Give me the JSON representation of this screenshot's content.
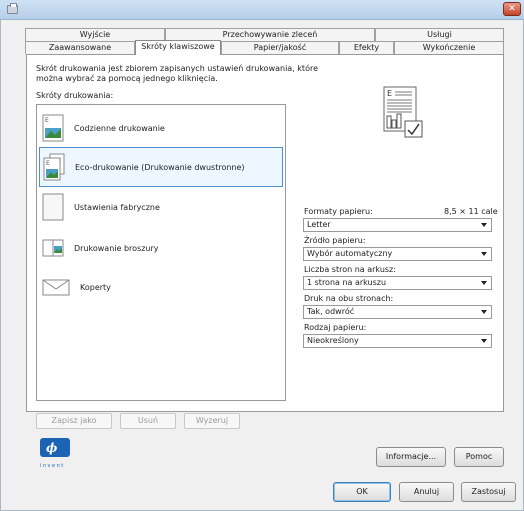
{
  "tabs_row1": [
    "Wyjście",
    "Przechowywanie zleceń",
    "Usługi"
  ],
  "tabs_row2": [
    "Zaawansowane",
    "Skróty klawiszowe",
    "Papier/jakość",
    "Efekty",
    "Wykończenie"
  ],
  "description": "Skrót drukowania jest zbiorem zapisanych ustawień drukowania, które można wybrać za pomocą jednego kliknięcia.",
  "shortcuts_label": "Skróty drukowania:",
  "shortcuts": [
    {
      "label": "Codzienne drukowanie",
      "icon": "doc-landscape-icon"
    },
    {
      "label": "Eco-drukowanie (Drukowanie dwustronne)",
      "icon": "duplex-doc-icon"
    },
    {
      "label": "Ustawienia fabryczne",
      "icon": "blank-page-icon"
    },
    {
      "label": "Drukowanie broszury",
      "icon": "booklet-icon"
    },
    {
      "label": "Koperty",
      "icon": "envelope-icon"
    }
  ],
  "list_buttons": {
    "save_as": "Zapisz jako",
    "delete": "Usuń",
    "reset": "Wyzeruj"
  },
  "paper_sizes_label": "Formaty papieru:",
  "paper_size_value": "8,5 × 11 cale",
  "paper_size_select": "Letter",
  "paper_source_label": "Źródło papieru:",
  "paper_source_select": "Wybór automatyczny",
  "pages_per_sheet_label": "Liczba stron na arkusz:",
  "pages_per_sheet_select": "1 strona na arkuszu",
  "duplex_label": "Druk na obu stronach:",
  "duplex_select": "Tak, odwróć",
  "paper_type_label": "Rodzaj papieru:",
  "paper_type_select": "Nieokreślony",
  "hp_tagline": "invent",
  "info_button": "Informacje...",
  "help_button": "Pomoc",
  "ok_button": "OK",
  "cancel_button": "Anuluj",
  "apply_button": "Zastosuj"
}
